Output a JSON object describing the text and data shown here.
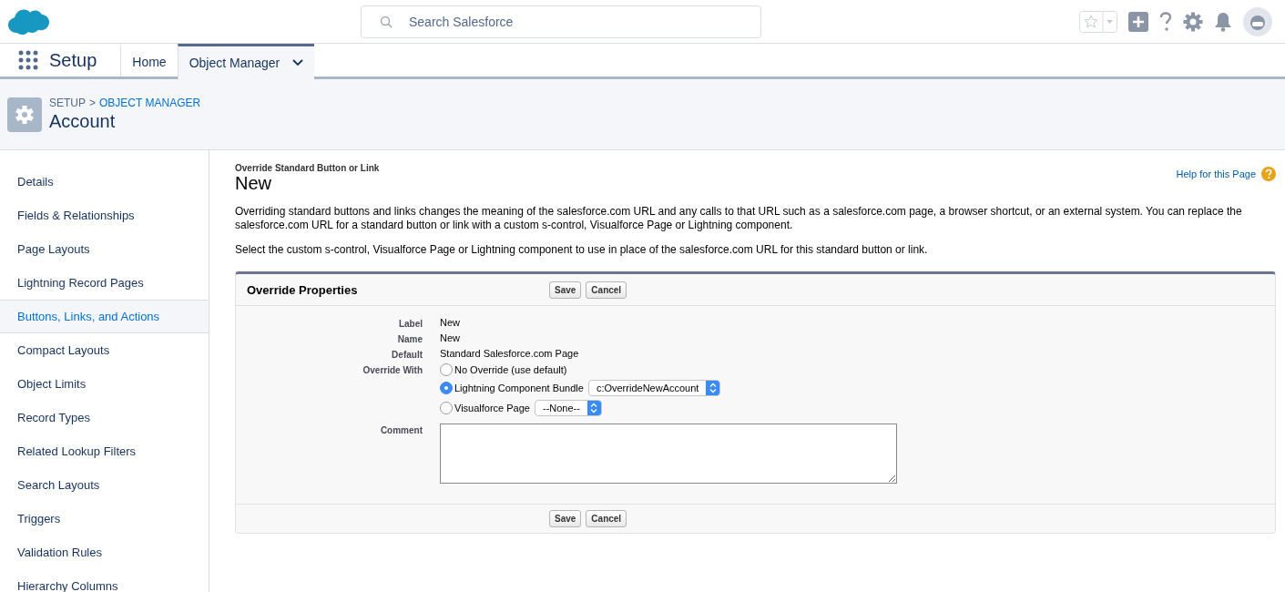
{
  "header": {
    "search": {
      "placeholder": "Search Salesforce"
    }
  },
  "nav": {
    "app_name": "Setup",
    "tabs": [
      {
        "label": "Home",
        "selected": false
      },
      {
        "label": "Object Manager",
        "selected": true
      }
    ]
  },
  "page_header": {
    "breadcrumb": [
      {
        "label": "SETUP",
        "link": false
      },
      {
        "label": "OBJECT MANAGER",
        "link": true
      }
    ],
    "separator": ">",
    "title": "Account"
  },
  "sidebar": {
    "items": [
      {
        "label": "Details",
        "selected": false
      },
      {
        "label": "Fields & Relationships",
        "selected": false
      },
      {
        "label": "Page Layouts",
        "selected": false
      },
      {
        "label": "Lightning Record Pages",
        "selected": false
      },
      {
        "label": "Buttons, Links, and Actions",
        "selected": true
      },
      {
        "label": "Compact Layouts",
        "selected": false
      },
      {
        "label": "Object Limits",
        "selected": false
      },
      {
        "label": "Record Types",
        "selected": false
      },
      {
        "label": "Related Lookup Filters",
        "selected": false
      },
      {
        "label": "Search Layouts",
        "selected": false
      },
      {
        "label": "Triggers",
        "selected": false
      },
      {
        "label": "Validation Rules",
        "selected": false
      },
      {
        "label": "Hierarchy Columns",
        "selected": false
      }
    ]
  },
  "content": {
    "subtitle": "Override Standard Button or Link",
    "title": "New",
    "help_link": "Help for this Page",
    "paragraphs": [
      "Overriding standard buttons and links changes the meaning of the salesforce.com URL and any calls to that URL such as a salesforce.com page, a browser shortcut, or an external system. You can replace the salesforce.com URL for a standard button or link with a custom s-control, Visualforce Page or Lightning component.",
      "Select the custom s-control, Visualforce Page or Lightning component to use in place of the salesforce.com URL for this standard button or link."
    ],
    "panel": {
      "title": "Override Properties",
      "top_buttons": [
        "Save",
        "Cancel"
      ],
      "bottom_buttons": [
        "Save",
        "Cancel"
      ],
      "fields": [
        {
          "label": "Label",
          "value": "New"
        },
        {
          "label": "Name",
          "value": "New"
        },
        {
          "label": "Default",
          "value": "Standard Salesforce.com Page"
        }
      ],
      "override_label": "Override With",
      "options": [
        {
          "label": "No Override (use default)",
          "selected": false
        },
        {
          "label": "Lightning Component Bundle",
          "selected": true,
          "select_value": "c:OverrideNewAccount"
        },
        {
          "label": "Visualforce Page",
          "selected": false,
          "select_value": "--None--"
        }
      ],
      "comment_label": "Comment"
    }
  }
}
